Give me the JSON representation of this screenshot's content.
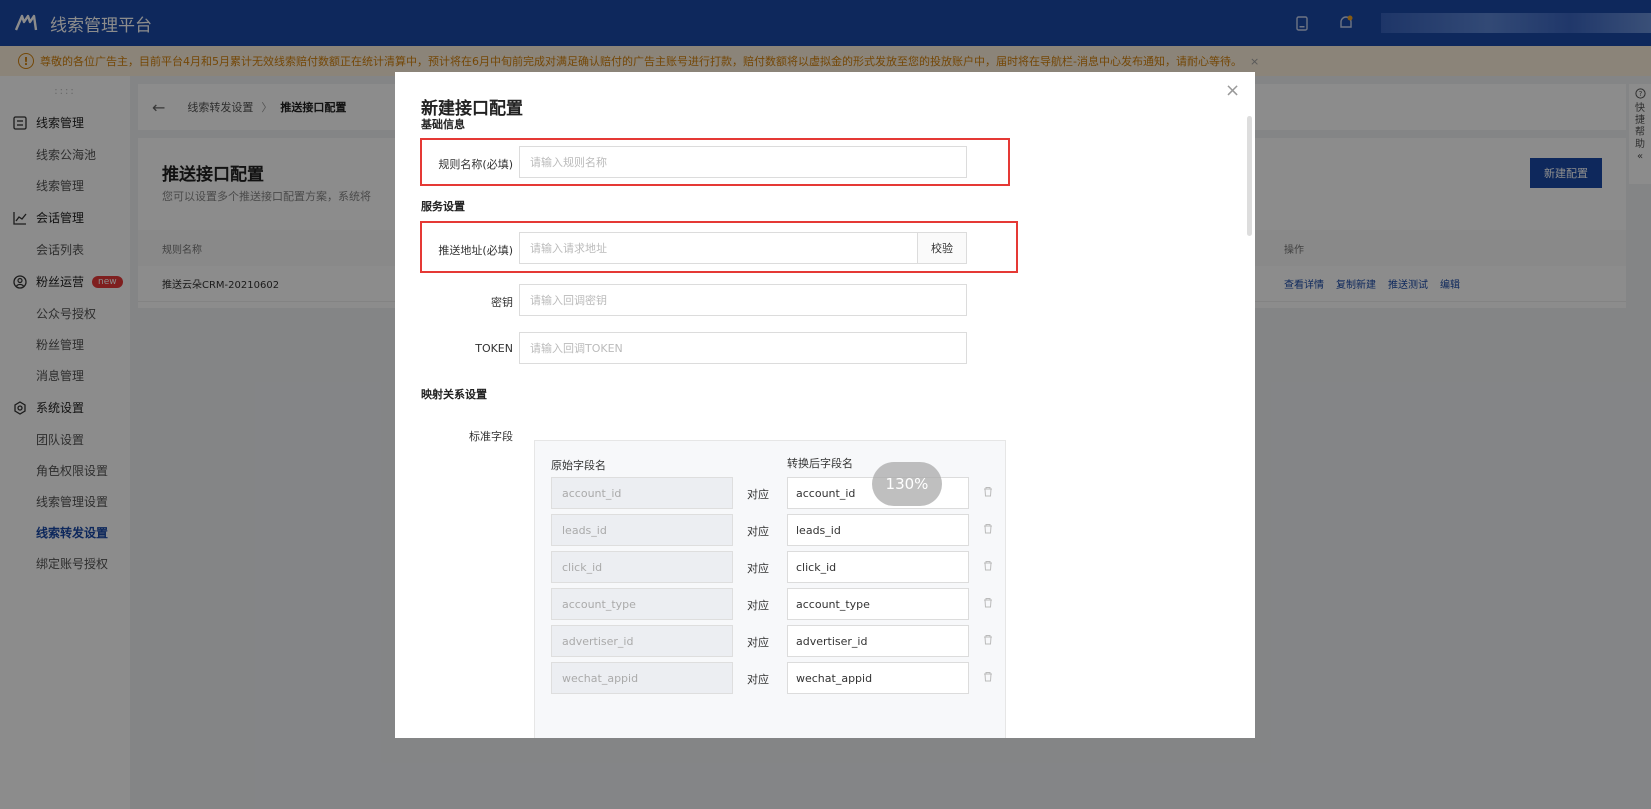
{
  "app": {
    "title": "线索管理平台"
  },
  "notice": {
    "icon": "exclamation-icon",
    "text": "尊敬的各位广告主，目前平台4月和5月累计无效线索赔付数额正在统计清算中，预计将在6月中旬前完成对满足确认赔付的广告主账号进行打款，赔付数额将以虚拟金的形式发放至您的投放账户中，届时将在导航栏-消息中心发布通知，请耐心等待。",
    "close": "×"
  },
  "sidebar": {
    "drag": "::::",
    "groups": [
      {
        "label": "线索管理",
        "icon": "list-box-icon",
        "items": [
          "线索公海池",
          "线索管理"
        ]
      },
      {
        "label": "会话管理",
        "icon": "line-chart-icon",
        "items": [
          "会话列表"
        ]
      },
      {
        "label": "粉丝运营",
        "icon": "user-circle-icon",
        "badge": "new",
        "items": [
          "公众号授权",
          "粉丝管理",
          "消息管理"
        ]
      },
      {
        "label": "系统设置",
        "icon": "gear-icon",
        "items": [
          "团队设置",
          "角色权限设置",
          "线索管理设置",
          "线索转发设置",
          "绑定账号授权"
        ]
      }
    ]
  },
  "breadcrumb": {
    "back": "←",
    "parent": "线索转发设置",
    "sep": "〉",
    "current": "推送接口配置"
  },
  "page": {
    "title": "推送接口配置",
    "desc": "您可以设置多个推送接口配置方案，系统将",
    "new_button": "新建配置",
    "table": {
      "headers": {
        "name": "规则名称",
        "ops": "操作"
      },
      "rows": [
        {
          "name": "推送云朵CRM-20210602",
          "ops": [
            "查看详情",
            "复制新建",
            "推送测试",
            "编辑"
          ]
        }
      ]
    }
  },
  "help": {
    "icon": "question-circle-icon",
    "text": [
      "快",
      "捷",
      "帮",
      "助"
    ],
    "collapse": "«"
  },
  "modal": {
    "title": "新建接口配置",
    "close": "×",
    "sections": {
      "basic": "基础信息",
      "service": "服务设置",
      "mapping": "映射关系设置"
    },
    "fields": {
      "rule_name": {
        "label": "规则名称(必填)",
        "placeholder": "请输入规则名称"
      },
      "push_url": {
        "label": "推送地址(必填)",
        "placeholder": "请输入请求地址",
        "button": "校验"
      },
      "secret": {
        "label": "密钥",
        "placeholder": "请输入回调密钥"
      },
      "token": {
        "label": "TOKEN",
        "placeholder": "请输入回调TOKEN"
      }
    },
    "mapping": {
      "label": "标准字段",
      "head_orig": "原始字段名",
      "head_new": "转换后字段名",
      "dui": "对应",
      "rows": [
        {
          "orig": "account_id",
          "new": "account_id"
        },
        {
          "orig": "leads_id",
          "new": "leads_id"
        },
        {
          "orig": "click_id",
          "new": "click_id"
        },
        {
          "orig": "account_type",
          "new": "account_type"
        },
        {
          "orig": "advertiser_id",
          "new": "advertiser_id"
        },
        {
          "orig": "wechat_appid",
          "new": "wechat_appid"
        }
      ]
    }
  },
  "zoom": "130%",
  "colors": {
    "brand": "#1a4aa8",
    "highlight": "#e53935",
    "notice_text": "#d4820d"
  }
}
